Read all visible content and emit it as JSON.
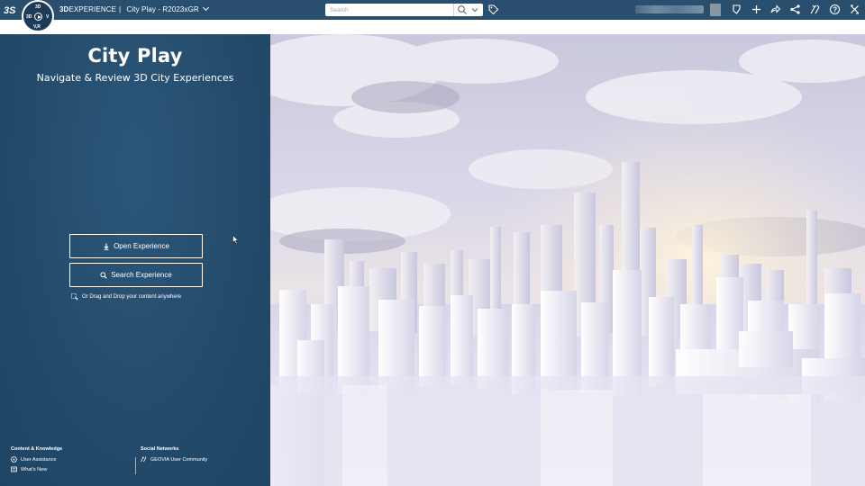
{
  "topbar": {
    "brand_bold": "3D",
    "brand_rest": "EXPERIENCE",
    "separator": "|",
    "app_name": "City Play - R2023xGR",
    "search_placeholder": "Search",
    "compass_labels": {
      "top": "3D",
      "left": "3D",
      "right": "V",
      "bottom": "V,R"
    }
  },
  "left_panel": {
    "title": "City Play",
    "subtitle": "Navigate & Review 3D City Experiences",
    "open_button": "Open Experience",
    "search_button": "Search Experience",
    "drag_hint": "Or Drag and Drop your content anywhere"
  },
  "footer": {
    "content_heading": "Content & Knowledge",
    "user_assistance": "User Assistance",
    "whats_new": "What's New",
    "social_heading": "Social Networks",
    "geovia_community": "GEOVIA User Community"
  },
  "colors": {
    "topbar": "#2a4f6e",
    "panel": "#244d6e",
    "white": "#ffffff"
  },
  "icons": [
    "ds-logo-icon",
    "compass-icon",
    "chevron-down-icon",
    "search-icon",
    "tag-icon",
    "bookmark-icon",
    "plus-icon",
    "share-icon",
    "network-icon",
    "tools-icon",
    "help-icon",
    "close-icon",
    "download-icon",
    "drag-drop-icon",
    "help-circle-icon",
    "news-icon",
    "community-icon"
  ]
}
